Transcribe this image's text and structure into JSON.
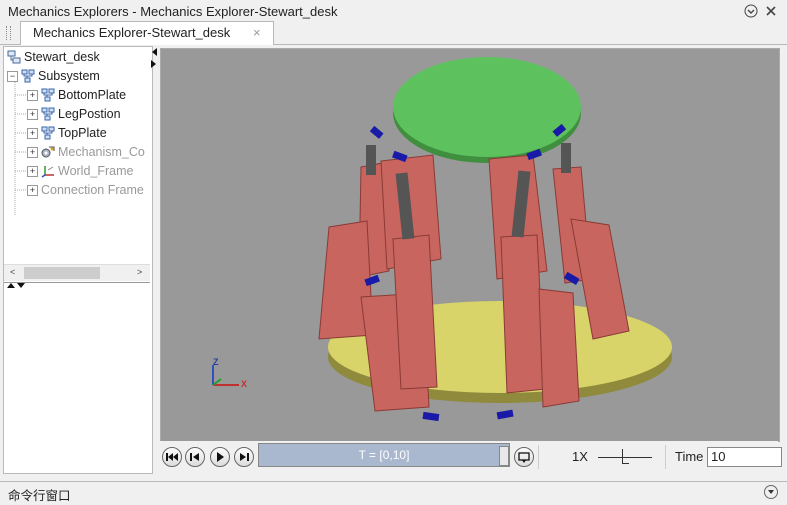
{
  "window": {
    "title": "Mechanics Explorers - Mechanics Explorer-Stewart_desk",
    "menu_icon": "chevron-circle-down-icon",
    "close_icon": "close-icon"
  },
  "tab": {
    "label": "Mechanics Explorer-Stewart_desk",
    "close_glyph": "×"
  },
  "tree": {
    "root": "Stewart_desk",
    "items": [
      {
        "label": "Subsystem",
        "expander": "−"
      },
      {
        "label": "BottomPlate",
        "expander": "+"
      },
      {
        "label": "LegPostion",
        "expander": "+"
      },
      {
        "label": "TopPlate",
        "expander": "+"
      },
      {
        "label": "Mechanism_Co",
        "expander": "+"
      },
      {
        "label": "World_Frame",
        "expander": "+"
      },
      {
        "label": "Connection Frame",
        "expander": "+"
      }
    ]
  },
  "scrollbar": {
    "left_arrow": "<",
    "right_arrow": ">"
  },
  "viewport": {
    "background": "#999999",
    "axis_labels": {
      "x": "X",
      "z": "Z"
    },
    "colors": {
      "top_plate": "#5dc15e",
      "base_plate": "#d8d46a",
      "legs": "#c8655f",
      "rods": "#555555",
      "joints": "#1a1aa8"
    }
  },
  "playback": {
    "buttons": [
      "rewind-icon",
      "step-back-icon",
      "play-icon",
      "step-forward-icon"
    ],
    "progress_label": "T = [0,10]",
    "speed": "1X",
    "time_label": "Time",
    "time_value": "10"
  },
  "command_window": {
    "label": "命令行窗口"
  }
}
